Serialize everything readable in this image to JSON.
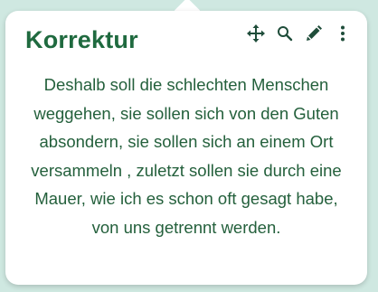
{
  "card": {
    "title": "Korrektur",
    "text": "Deshalb soll die schlechten Menschen weggehen, sie sollen sich von den Guten absondern, sie sollen sich an einem Ort versammeln , zuletzt sollen sie durch eine Mauer, wie ich es schon oft gesagt habe, von uns getrennt werden."
  },
  "toolbar": {
    "icons": [
      "move-icon",
      "search-icon",
      "pencil-icon",
      "more-vertical-icon"
    ]
  },
  "colors": {
    "background": "#cfe8e1",
    "title": "#1f6a3f",
    "text": "#24603c",
    "icons": "#1f4d3a"
  }
}
